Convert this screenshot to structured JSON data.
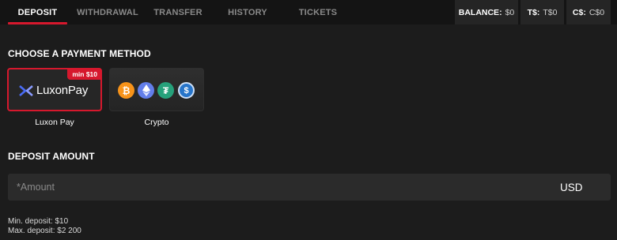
{
  "tabs": [
    {
      "label": "DEPOSIT",
      "active": true
    },
    {
      "label": "WITHDRAWAL",
      "active": false
    },
    {
      "label": "TRANSFER",
      "active": false
    },
    {
      "label": "HISTORY",
      "active": false
    },
    {
      "label": "TICKETS",
      "active": false
    }
  ],
  "balances": [
    {
      "label": "BALANCE:",
      "value": "$0"
    },
    {
      "label": "T$:",
      "value": "T$0"
    },
    {
      "label": "C$:",
      "value": "C$0"
    }
  ],
  "payment_section": {
    "title": "CHOOSE A PAYMENT METHOD",
    "methods": [
      {
        "label": "Luxon Pay",
        "logo_text": "LuxonPay",
        "badge": "min $10",
        "selected": true
      },
      {
        "label": "Crypto",
        "icons": [
          "bitcoin-icon",
          "ethereum-icon",
          "tether-icon",
          "usdc-icon"
        ],
        "selected": false
      }
    ]
  },
  "deposit_section": {
    "title": "DEPOSIT AMOUNT",
    "amount_placeholder": "*Amount",
    "amount_value": "",
    "currency": "USD",
    "min_deposit": "Min. deposit: $10",
    "max_deposit": "Max. deposit: $2 200"
  },
  "colors": {
    "accent": "#d6182d",
    "background": "#1c1c1c",
    "topbar": "#141414",
    "bitcoin": "#f7931a",
    "ethereum": "#627eea",
    "tether": "#26a17b",
    "usdc": "#2775ca"
  }
}
